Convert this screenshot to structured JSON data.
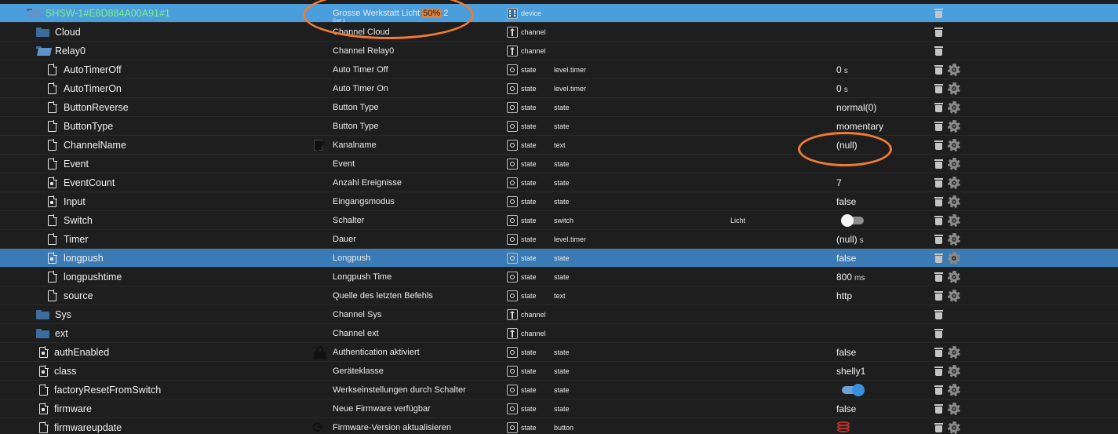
{
  "rows": [
    {
      "id": "device",
      "name": "SHSW-1#E8D884A00A91#1",
      "desc": "Grosse Werkstatt Licht",
      "desc_highlight": "50%",
      "desc_suffix": "2",
      "gen_above": "Gen 1",
      "gen_below": "Gen 1",
      "type": "device",
      "role": "",
      "room": "",
      "value": "",
      "unit": ""
    },
    {
      "id": "cloud",
      "name": "Cloud",
      "desc": "Channel Cloud",
      "type": "channel"
    },
    {
      "id": "relay0",
      "name": "Relay0",
      "desc": "Channel Relay0",
      "type": "channel"
    },
    {
      "id": "autotimeroff",
      "name": "AutoTimerOff",
      "desc": "Auto Timer Off",
      "type": "state",
      "role": "level.timer",
      "value": "0",
      "unit": "s"
    },
    {
      "id": "autotimeron",
      "name": "AutoTimerOn",
      "desc": "Auto Timer On",
      "type": "state",
      "role": "level.timer",
      "value": "0",
      "unit": "s"
    },
    {
      "id": "buttonreverse",
      "name": "ButtonReverse",
      "desc": "Button Type",
      "type": "state",
      "role": "state",
      "value": "normal(0)"
    },
    {
      "id": "buttontype",
      "name": "ButtonType",
      "desc": "Button Type",
      "type": "state",
      "role": "state",
      "value": "momentary"
    },
    {
      "id": "channelname",
      "name": "ChannelName",
      "desc": "Kanalname",
      "type": "state",
      "role": "text",
      "value": "(null)"
    },
    {
      "id": "event",
      "name": "Event",
      "desc": "Event",
      "type": "state",
      "role": "state",
      "value": ""
    },
    {
      "id": "eventcount",
      "name": "EventCount",
      "desc": "Anzahl Ereignisse",
      "type": "state",
      "role": "state",
      "value": "7"
    },
    {
      "id": "input",
      "name": "Input",
      "desc": "Eingangsmodus",
      "type": "state",
      "role": "state",
      "value": "false"
    },
    {
      "id": "switch",
      "name": "Switch",
      "desc": "Schalter",
      "type": "state",
      "role": "switch",
      "room": "Licht",
      "value": "",
      "toggle": false
    },
    {
      "id": "timer",
      "name": "Timer",
      "desc": "Dauer",
      "type": "state",
      "role": "level.timer",
      "value": "(null)",
      "unit": "s"
    },
    {
      "id": "longpush",
      "name": "longpush",
      "desc": "Longpush",
      "type": "state",
      "role": "state",
      "value": "false"
    },
    {
      "id": "longpushtime",
      "name": "longpushtime",
      "desc": "Longpush Time",
      "type": "state",
      "role": "state",
      "value": "800",
      "unit": "ms"
    },
    {
      "id": "source",
      "name": "source",
      "desc": "Quelle des letzten Befehls",
      "type": "state",
      "role": "text",
      "value": "http"
    },
    {
      "id": "sys",
      "name": "Sys",
      "desc": "Channel Sys",
      "type": "channel"
    },
    {
      "id": "ext",
      "name": "ext",
      "desc": "Channel ext",
      "type": "channel"
    },
    {
      "id": "authenabled",
      "name": "authEnabled",
      "desc": "Authentication aktiviert",
      "type": "state",
      "role": "state",
      "value": "false"
    },
    {
      "id": "class",
      "name": "class",
      "desc": "Geräteklasse",
      "type": "state",
      "role": "state",
      "value": "shelly1"
    },
    {
      "id": "factoryreset",
      "name": "factoryResetFromSwitch",
      "desc": "Werkseinstellungen durch Schalter",
      "type": "state",
      "role": "state",
      "value": "",
      "toggle": true
    },
    {
      "id": "firmware",
      "name": "firmware",
      "desc": "Neue Firmware verfügbar",
      "type": "state",
      "role": "state",
      "value": "false"
    },
    {
      "id": "firmwareupdate",
      "name": "firmwareupdate",
      "desc": "Firmware-Version aktualisieren",
      "type": "state",
      "role": "button",
      "value": ""
    }
  ],
  "icons": {
    "folder": "folder-icon",
    "file": "file-icon",
    "trash": "trash-icon",
    "gear": "gear-icon",
    "state": "state-type-icon",
    "channel": "channel-type-icon",
    "device": "device-type-icon"
  },
  "colors": {
    "background": "#1e1e1e",
    "selected_device_row": "#4a9edc",
    "selected_item_row": "#3a7bb5",
    "device_name": "#7cf08a",
    "annotation": "#f07a34",
    "highlight": "#e0803a"
  }
}
